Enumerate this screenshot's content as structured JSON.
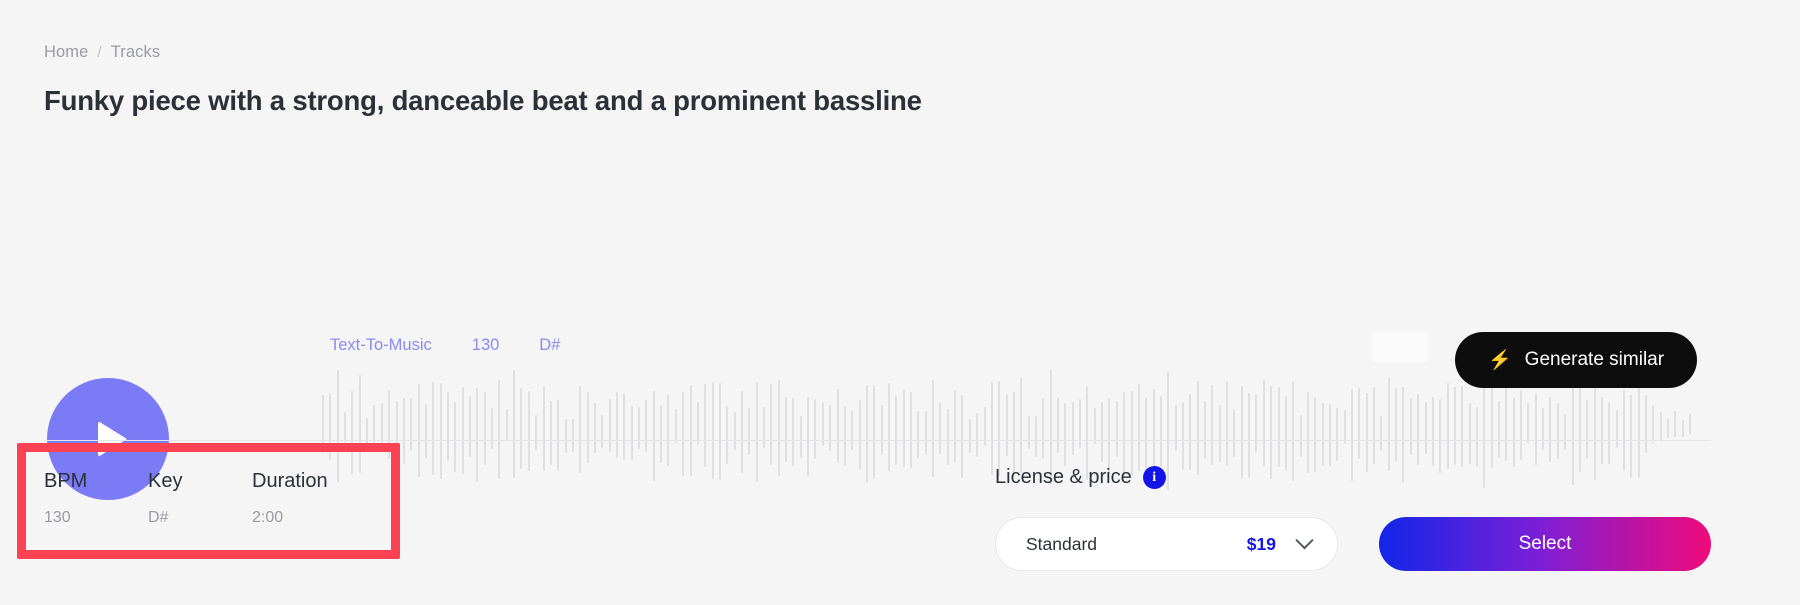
{
  "breadcrumb": {
    "home": "Home",
    "separator": "/",
    "tracks": "Tracks"
  },
  "track": {
    "title": "Funky piece with a strong, danceable beat and a prominent bassline"
  },
  "player": {
    "play_label": "play-button",
    "tags": [
      "Text-To-Music",
      "130",
      "D#"
    ],
    "generate_similar": {
      "icon": "⚡",
      "label": "Generate similar"
    }
  },
  "meta": {
    "columns": [
      {
        "label": "BPM",
        "value": "130"
      },
      {
        "label": "Key",
        "value": "D#"
      },
      {
        "label": "Duration",
        "value": "2:00"
      }
    ]
  },
  "license": {
    "heading": "License & price",
    "info_icon": "i",
    "selected": {
      "name": "Standard",
      "price": "$19"
    },
    "select_button": "Select"
  },
  "colors": {
    "accent_purple": "#7b7bf5",
    "tag_purple": "#8a8af0",
    "info_blue": "#1414e6",
    "highlight_red": "#fa4252",
    "gradient_start": "#1226e8",
    "gradient_end": "#ef0a7b",
    "background": "#f5f5f6"
  }
}
